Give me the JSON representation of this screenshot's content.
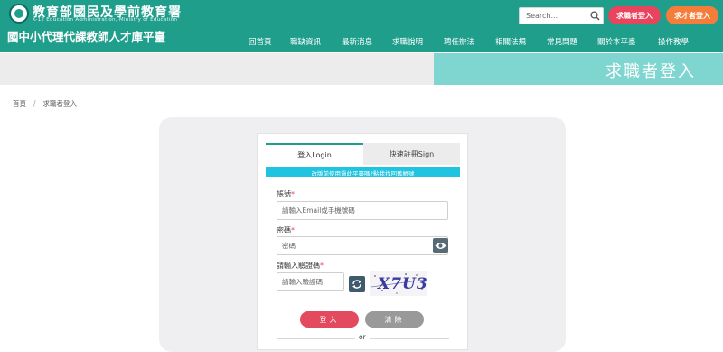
{
  "header": {
    "ministry_name": "教育部國民及學前教育署",
    "ministry_en": "K-12 Education Administration, Ministry of Education",
    "site_title": "國中小代理代課教師人才庫平臺",
    "search": {
      "placeholder": "Search..."
    },
    "job_seeker_button": "求職者登入",
    "talent_seeker_button": "求才者登入",
    "nav": [
      "回首頁",
      "職缺資訊",
      "最新消息",
      "求職說明",
      "聘任辦法",
      "相關法規",
      "常見問題",
      "關於本平臺",
      "操作教學"
    ]
  },
  "banner": {
    "title": "求職者登入"
  },
  "breadcrumb": {
    "home": "首頁",
    "separator": "/",
    "current": "求職者登入"
  },
  "login": {
    "tabs": [
      "登入Login",
      "快速註冊Sign"
    ],
    "notice": "改版前使用過此平臺嗎?點我找回舊帳號",
    "account_label": "帳號",
    "account_placeholder": "請輸入Email或手機號碼",
    "password_label": "密碼",
    "password_placeholder": "密碼",
    "captcha_label": "請輸入驗證碼",
    "captcha_placeholder": "請輸入驗證碼",
    "captcha_text": "X7U3",
    "required_mark": "*",
    "login_button": "登入",
    "clear_button": "清除",
    "or_text": "or"
  },
  "colors": {
    "primary": "#1f9e8c",
    "accent_pink": "#e8445e",
    "accent_orange": "#f47d3b",
    "notice": "#20c4e0"
  }
}
